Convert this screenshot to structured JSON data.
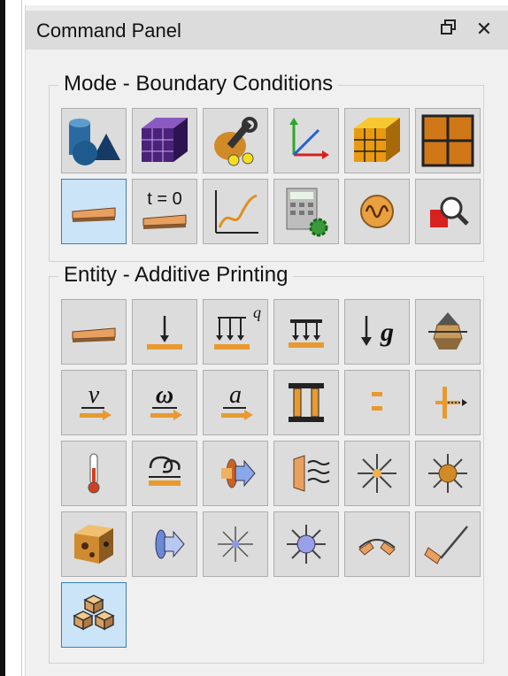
{
  "panel": {
    "title": "Command Panel",
    "restore_icon": "restore-icon",
    "close_icon": "close-icon"
  },
  "mode_group": {
    "label": "Mode - Boundary Conditions",
    "buttons": [
      {
        "name": "geometry-icon",
        "selected": false
      },
      {
        "name": "mesh-icon",
        "selected": false
      },
      {
        "name": "material-tools-icon",
        "selected": false
      },
      {
        "name": "coordinate-system-icon",
        "selected": false
      },
      {
        "name": "elements-icon",
        "selected": false
      },
      {
        "name": "nodes-grid-icon",
        "selected": false
      },
      {
        "name": "boundary-conditions-icon",
        "selected": true
      },
      {
        "name": "initial-conditions-icon",
        "selected": false,
        "text": "t = 0"
      },
      {
        "name": "curve-plot-icon",
        "selected": false
      },
      {
        "name": "calculator-settings-icon",
        "selected": false
      },
      {
        "name": "waveform-icon",
        "selected": false
      },
      {
        "name": "inspect-icon",
        "selected": false
      }
    ]
  },
  "entity_group": {
    "label": "Entity - Additive Printing",
    "buttons": [
      {
        "name": "slab-icon",
        "selected": false
      },
      {
        "name": "point-load-icon",
        "selected": false
      },
      {
        "name": "distributed-load-icon",
        "selected": false,
        "text": "q"
      },
      {
        "name": "pressure-load-icon",
        "selected": false
      },
      {
        "name": "gravity-icon",
        "selected": false,
        "text": "g"
      },
      {
        "name": "fixed-support-icon",
        "selected": false
      },
      {
        "name": "velocity-icon",
        "selected": false,
        "text": "v"
      },
      {
        "name": "angular-velocity-icon",
        "selected": false,
        "text": "ω"
      },
      {
        "name": "acceleration-icon",
        "selected": false,
        "text": "a"
      },
      {
        "name": "column-icon",
        "selected": false
      },
      {
        "name": "contact-icon",
        "selected": false
      },
      {
        "name": "displacement-icon",
        "selected": false
      },
      {
        "name": "thermometer-icon",
        "selected": false
      },
      {
        "name": "convection-icon",
        "selected": false
      },
      {
        "name": "heat-flux-icon",
        "selected": false
      },
      {
        "name": "radiation-icon",
        "selected": false
      },
      {
        "name": "light-source-icon",
        "selected": false
      },
      {
        "name": "sun-icon",
        "selected": false
      },
      {
        "name": "material-block-icon",
        "selected": false
      },
      {
        "name": "flow-arrow-icon",
        "selected": false
      },
      {
        "name": "point-source-icon",
        "selected": false
      },
      {
        "name": "sphere-light-icon",
        "selected": false
      },
      {
        "name": "bend-icon",
        "selected": false
      },
      {
        "name": "angle-icon",
        "selected": false
      },
      {
        "name": "additive-printing-icon",
        "selected": true
      }
    ]
  }
}
